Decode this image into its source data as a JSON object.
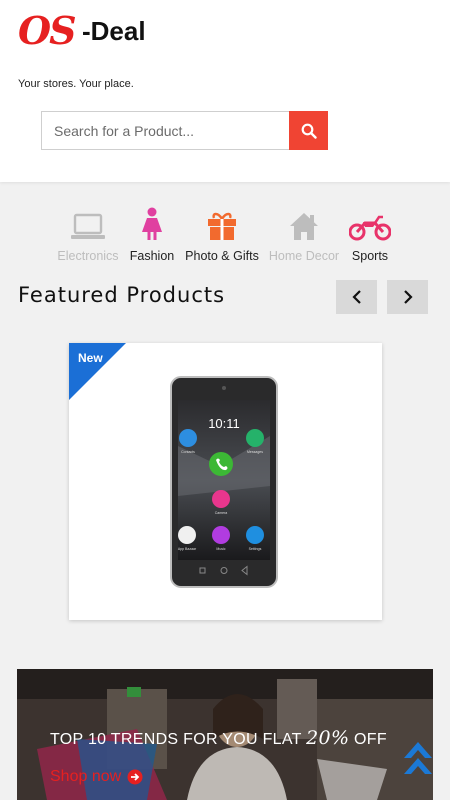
{
  "header": {
    "logo_os": "OS",
    "logo_deal": "-Deal",
    "tagline": "Your stores. Your place."
  },
  "search": {
    "placeholder": "Search for a Product...",
    "icon": "search-icon",
    "button_color": "#f04433"
  },
  "categories": [
    {
      "label": "Electronics",
      "icon": "laptop-icon",
      "color": "#bdbdbd"
    },
    {
      "label": "Fashion",
      "icon": "woman-icon",
      "color": "#e040a0"
    },
    {
      "label": "Photo & Gifts",
      "icon": "gift-icon",
      "color": "#f26a2e"
    },
    {
      "label": "Home Decor",
      "icon": "home-icon",
      "color": "#bdbdbd"
    },
    {
      "label": "Sports",
      "icon": "motorcycle-icon",
      "color": "#e8336a"
    }
  ],
  "featured": {
    "title": "Featured Products",
    "prev_icon": "chevron-left-icon",
    "next_icon": "chevron-right-icon"
  },
  "product": {
    "badge": "New",
    "badge_color": "#1b6fd6",
    "phone_time": "10:11",
    "app_labels": [
      "Contacts",
      "Messages",
      "Camera",
      "App Bazaar",
      "Music",
      "Settings"
    ]
  },
  "banner": {
    "headline_prefix": "TOP 10 TRENDS FOR YOU FLAT ",
    "headline_pct": "20%",
    "headline_suffix": " OFF",
    "cta": "Shop now",
    "cta_color": "#e62020"
  },
  "scroll_top_icon": "double-chevron-up-icon"
}
